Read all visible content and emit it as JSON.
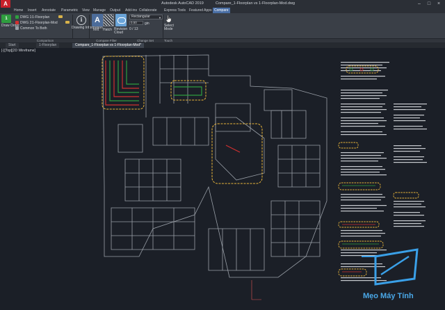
{
  "titlebar": {
    "app_logo": "A",
    "app_name": "Autodesk AutoCAD 2019",
    "document_name": "Compare_1-Floorplan vs 1-Floorplan-Mod.dwg",
    "minimize": "–",
    "maximize": "□",
    "close": "×"
  },
  "ribbon_tabs": [
    "Home",
    "Insert",
    "Annotate",
    "Parametric",
    "View",
    "Manage",
    "Output",
    "Add-ins",
    "Collaborate",
    "Express Tools",
    "Featured Apps",
    "Compare"
  ],
  "ribbon": {
    "draw_order_label": "Draw Order",
    "dwg1_label": "DWG 1:",
    "dwg1_value": "1-Floorplan",
    "dwg2_label": "DWG 2:",
    "dwg2_value": "1-Floorplan-Mod",
    "common_label": "Common To Both",
    "drawing_info_label": "Drawing Information",
    "text_label": "Text",
    "hatch_label": "Hatch",
    "revision_cloud_label": "Revision Cloud",
    "shape_value": "Rectangular",
    "margin_value": "0.50",
    "margin_unit": "gin",
    "nav_text": "0 / 13",
    "select_mode_label": "Select Mode",
    "panels": {
      "comparison": "Comparison",
      "compare_filter": "Compare Filter",
      "change_set": "Change Set",
      "touch": "Touch"
    },
    "colors": {
      "dwg1": "#2f9e3f",
      "dwg2": "#d03030",
      "common": "#9aa0a8",
      "cloud": "#e8b43a"
    }
  },
  "doc_tabs": [
    "Start",
    "1-Floorplan",
    "Compare_1-Floorplan vs 1-Floorplan-Mod*"
  ],
  "viewport": {
    "label": "[-][Top][2D Wireframe]"
  },
  "watermark": {
    "text": "Mẹo Máy Tính"
  }
}
